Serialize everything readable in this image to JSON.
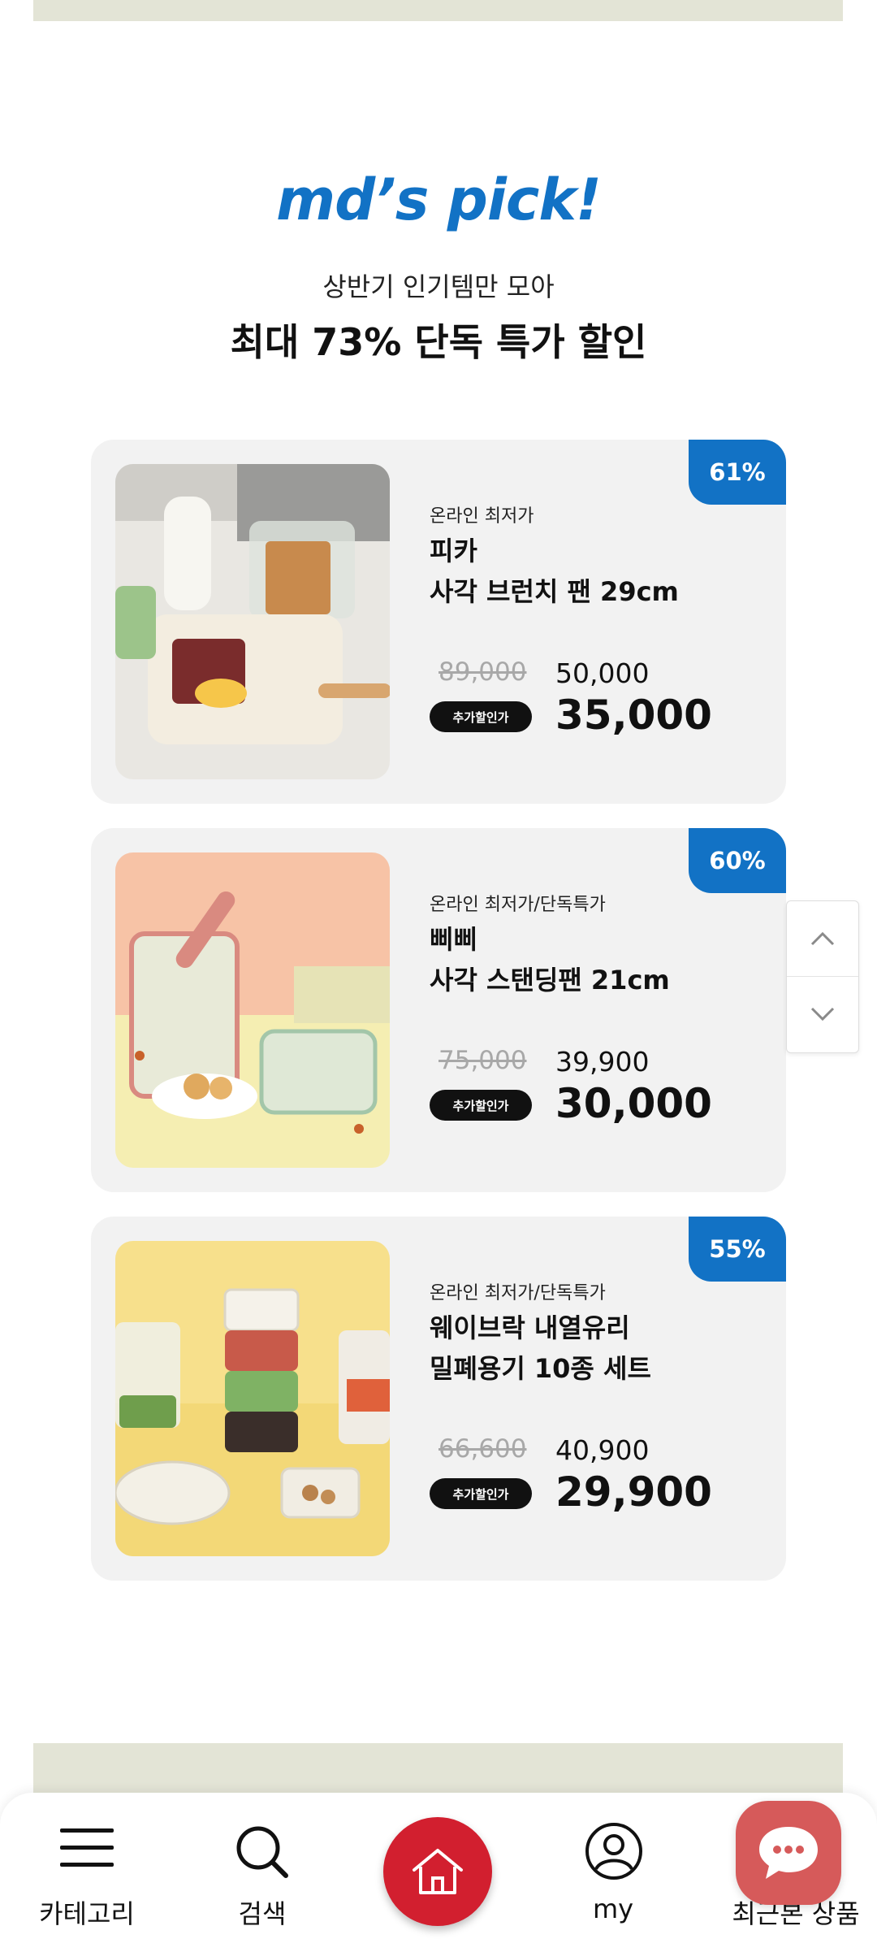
{
  "hero": {
    "title": "md’s pick!",
    "subtitle": "상반기 인기템만 모아",
    "headline": "최대 73% 단독 특가 할인"
  },
  "products": [
    {
      "badge": "61%",
      "label": "온라인 최저가",
      "brand": "피카",
      "name": "사각 브런치 팬 29cm",
      "original_price": "89,000",
      "sale_price": "50,000",
      "extra_label": "추가할인가",
      "final_price": "35,000"
    },
    {
      "badge": "60%",
      "label": "온라인 최저가/단독특가",
      "brand": "삐삐",
      "name": "사각 스탠딩팬 21cm",
      "original_price": "75,000",
      "sale_price": "39,900",
      "extra_label": "추가할인가",
      "final_price": "30,000"
    },
    {
      "badge": "55%",
      "label": "온라인 최저가/단독특가",
      "brand": "웨이브락 내열유리",
      "name": "밀폐용기 10종 세트",
      "original_price": "66,600",
      "sale_price": "40,900",
      "extra_label": "추가할인가",
      "final_price": "29,900"
    }
  ],
  "scroll": {
    "up_icon": "chevron-up-icon",
    "down_icon": "chevron-down-icon"
  },
  "nav": {
    "category": "카테고리",
    "search": "검색",
    "my": "my",
    "recent": "최근본 상품"
  },
  "colors": {
    "accent": "#1272c5",
    "home": "#d21f2f",
    "chat": "#d65a5a",
    "band": "#e3e4d6"
  }
}
